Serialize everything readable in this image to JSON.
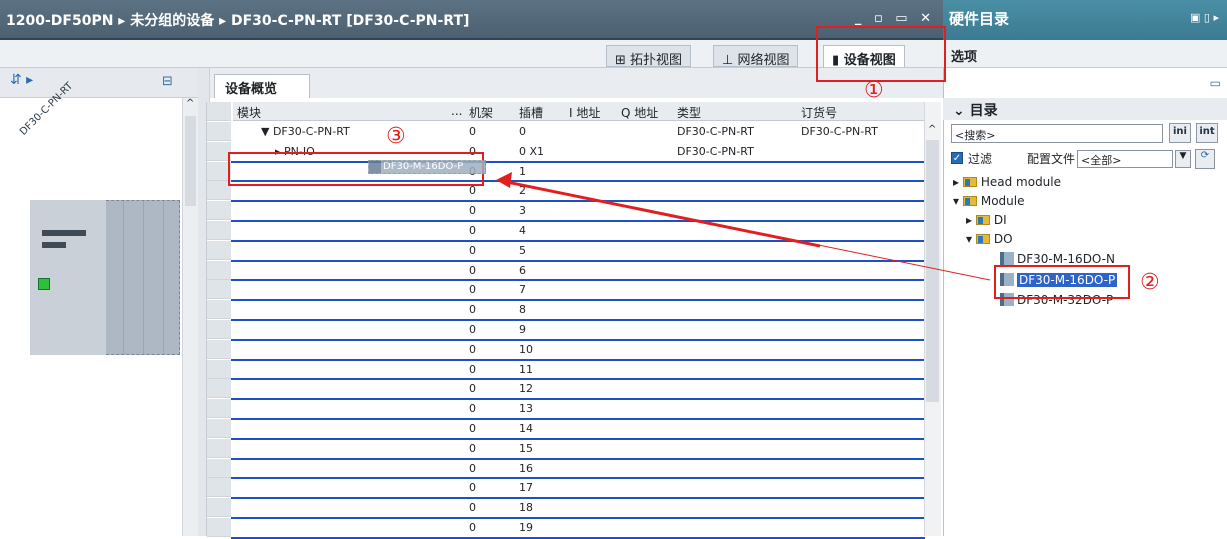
{
  "breadcrumb": {
    "project": "1200-DF50PN",
    "group": "未分组的设备",
    "device": "DF30-C-PN-RT [DF30-C-PN-RT]"
  },
  "window_buttons": "_ ▫ ▭ ✕",
  "hardware_catalog_title": "硬件目录",
  "view_tabs": {
    "topology": "拓扑视图",
    "network": "网络视图",
    "device": "设备视图"
  },
  "options_label": "选项",
  "device_name": "DF30-C-PN-RT",
  "overview_tab": "设备概览",
  "columns": {
    "module": "模块",
    "more": "...",
    "rack": "机架",
    "slot": "插槽",
    "i_addr": "I 地址",
    "q_addr": "Q 地址",
    "type": "类型",
    "order": "订货号"
  },
  "rows": [
    {
      "module": "▼ DF30-C-PN-RT",
      "rack": "0",
      "slot": "0",
      "type": "DF30-C-PN-RT",
      "order": "DF30-C-PN-RT"
    },
    {
      "module": "▸ PN-IO",
      "rack": "0",
      "slot": "0 X1",
      "type": "DF30-C-PN-RT",
      "order": ""
    },
    {
      "module": "",
      "rack": "0",
      "slot": "1",
      "type": "",
      "order": ""
    },
    {
      "module": "",
      "rack": "0",
      "slot": "2",
      "type": "",
      "order": ""
    },
    {
      "module": "",
      "rack": "0",
      "slot": "3",
      "type": "",
      "order": ""
    },
    {
      "module": "",
      "rack": "0",
      "slot": "4",
      "type": "",
      "order": ""
    },
    {
      "module": "",
      "rack": "0",
      "slot": "5",
      "type": "",
      "order": ""
    },
    {
      "module": "",
      "rack": "0",
      "slot": "6",
      "type": "",
      "order": ""
    },
    {
      "module": "",
      "rack": "0",
      "slot": "7",
      "type": "",
      "order": ""
    },
    {
      "module": "",
      "rack": "0",
      "slot": "8",
      "type": "",
      "order": ""
    },
    {
      "module": "",
      "rack": "0",
      "slot": "9",
      "type": "",
      "order": ""
    },
    {
      "module": "",
      "rack": "0",
      "slot": "10",
      "type": "",
      "order": ""
    },
    {
      "module": "",
      "rack": "0",
      "slot": "11",
      "type": "",
      "order": ""
    },
    {
      "module": "",
      "rack": "0",
      "slot": "12",
      "type": "",
      "order": ""
    },
    {
      "module": "",
      "rack": "0",
      "slot": "13",
      "type": "",
      "order": ""
    },
    {
      "module": "",
      "rack": "0",
      "slot": "14",
      "type": "",
      "order": ""
    },
    {
      "module": "",
      "rack": "0",
      "slot": "15",
      "type": "",
      "order": ""
    },
    {
      "module": "",
      "rack": "0",
      "slot": "16",
      "type": "",
      "order": ""
    },
    {
      "module": "",
      "rack": "0",
      "slot": "17",
      "type": "",
      "order": ""
    },
    {
      "module": "",
      "rack": "0",
      "slot": "18",
      "type": "",
      "order": ""
    },
    {
      "module": "",
      "rack": "0",
      "slot": "19",
      "type": "",
      "order": ""
    }
  ],
  "dragging_label": "DF30-M-16DO-P",
  "catalog": {
    "heading": "目录",
    "search_placeholder": "<搜索>",
    "filter_label": "过滤",
    "profile_label": "配置文件",
    "profile_value": "<全部>",
    "tree": [
      {
        "label": "Head module"
      },
      {
        "label": "Module"
      },
      {
        "label": "DI"
      },
      {
        "label": "DO"
      },
      {
        "label": "DF30-M-16DO-N"
      },
      {
        "label": "DF30-M-16DO-P"
      },
      {
        "label": "DF30-M-32DO-P"
      }
    ]
  },
  "annotations": {
    "one": "①",
    "two": "②",
    "three": "③"
  },
  "colors": {
    "annotation": "#e02020",
    "insert_line": "#1f4fc7",
    "selection": "#2e63c8"
  }
}
